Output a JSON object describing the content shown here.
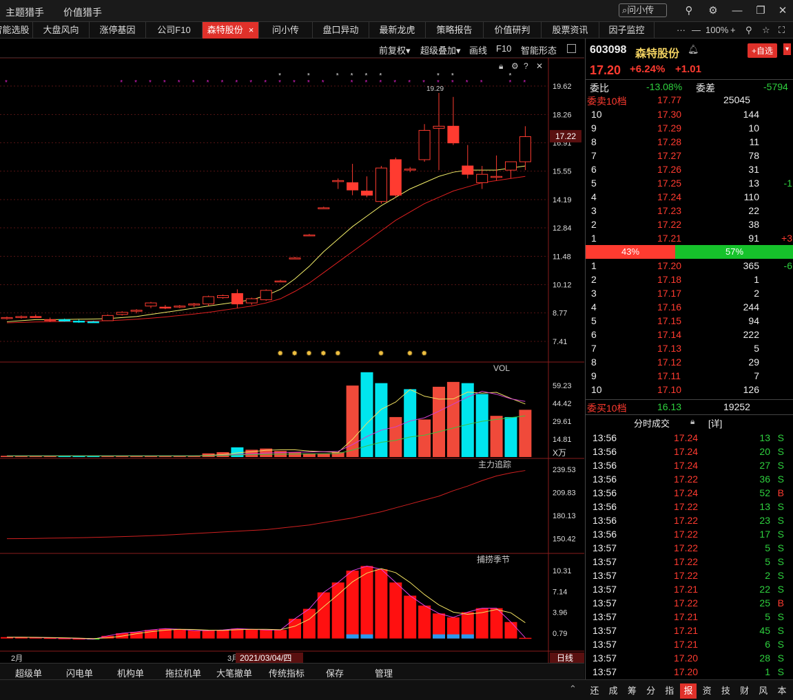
{
  "topmenu": [
    "主题猎手",
    "价值猎手"
  ],
  "search_label": "问小传",
  "tabs": [
    "智能选股",
    "大盘风向",
    "涨停基因",
    "公司F10",
    "森特股份",
    "问小传",
    "盘口异动",
    "最新龙虎",
    "策略报告",
    "价值研判",
    "股票资讯",
    "因子监控"
  ],
  "tab_close": "×",
  "tab_tools": {
    "more": "···",
    "minus": "—",
    "zoom": "100%",
    "plus": "+"
  },
  "toolbar": [
    "前复权▾",
    "超级叠加▾",
    "画线",
    "F10",
    "智能形态"
  ],
  "main_chart": {
    "y_labels": [
      "19.62",
      "18.26",
      "16.91",
      "15.55",
      "14.19",
      "12.84",
      "11.48",
      "10.12",
      "8.77",
      "7.41"
    ],
    "current_price": "17.22",
    "high_label": "19.29",
    "x_labels": [
      "2月",
      "3月"
    ],
    "date_tooltip": "2021/03/04/四",
    "period": "日线"
  },
  "vol_panel": {
    "title": "VOL",
    "y_labels": [
      "59.23",
      "44.42",
      "29.61",
      "14.81"
    ],
    "unit": "X万"
  },
  "main_force_panel": {
    "title": "主力追踪",
    "y_labels": [
      "239.53",
      "209.83",
      "180.13",
      "150.42"
    ]
  },
  "season_panel": {
    "title": "捕捞季节",
    "y_labels": [
      "10.31",
      "7.14",
      "3.96",
      "0.79"
    ]
  },
  "chart_data": {
    "type": "candlestick",
    "candles": [
      [
        8.5,
        8.6,
        8.45,
        8.55
      ],
      [
        8.55,
        8.65,
        8.5,
        8.6
      ],
      [
        8.6,
        8.7,
        8.55,
        8.55
      ],
      [
        8.45,
        8.55,
        8.35,
        8.4
      ],
      [
        8.45,
        8.5,
        8.35,
        8.38
      ],
      [
        8.38,
        8.45,
        8.3,
        8.33
      ],
      [
        8.35,
        8.4,
        8.3,
        8.32
      ],
      [
        8.4,
        8.7,
        8.38,
        8.65
      ],
      [
        8.7,
        8.85,
        8.65,
        8.8
      ],
      [
        8.85,
        8.95,
        8.75,
        8.9
      ],
      [
        9.1,
        9.3,
        9.0,
        9.25
      ],
      [
        9.05,
        9.15,
        8.95,
        9.0
      ],
      [
        9.05,
        9.15,
        9.0,
        9.1
      ],
      [
        9.15,
        9.25,
        9.05,
        9.2
      ],
      [
        9.2,
        9.6,
        9.1,
        9.55
      ],
      [
        9.5,
        9.65,
        9.45,
        9.6
      ],
      [
        9.7,
        9.9,
        9.0,
        9.2
      ],
      [
        9.25,
        9.5,
        9.15,
        9.45
      ],
      [
        9.4,
        9.9,
        9.35,
        9.85
      ],
      [
        10.3,
        10.35,
        10.25,
        10.3
      ],
      [
        11.4,
        11.45,
        11.35,
        11.4
      ],
      [
        12.5,
        12.55,
        12.45,
        12.5
      ],
      [
        13.8,
        13.85,
        13.75,
        13.8
      ],
      [
        15.1,
        15.2,
        14.7,
        15.1
      ],
      [
        15.0,
        15.9,
        14.4,
        14.65
      ],
      [
        14.6,
        15.3,
        14.3,
        14.4
      ],
      [
        14.1,
        15.8,
        14.0,
        15.7
      ],
      [
        16.1,
        16.2,
        14.3,
        14.4
      ],
      [
        15.6,
        15.75,
        15.5,
        15.65
      ],
      [
        16.1,
        17.8,
        16.0,
        17.5
      ],
      [
        17.6,
        19.29,
        15.6,
        17.7
      ],
      [
        17.7,
        19.1,
        16.8,
        16.9
      ],
      [
        15.8,
        16.8,
        15.2,
        15.4
      ],
      [
        15.0,
        15.8,
        14.7,
        15.4
      ],
      [
        15.25,
        16.3,
        15.1,
        15.3
      ],
      [
        15.6,
        16.0,
        15.2,
        16.0
      ],
      [
        16.0,
        17.7,
        15.6,
        17.2
      ]
    ],
    "ma_short": [
      8.35,
      8.4,
      8.45,
      8.45,
      8.46,
      8.47,
      8.48,
      8.5,
      8.55,
      8.6,
      8.7,
      8.8,
      8.9,
      9.0,
      9.1,
      9.2,
      9.3,
      9.4,
      9.6,
      9.9,
      10.4,
      11.0,
      11.7,
      12.3,
      12.9,
      13.4,
      13.9,
      14.3,
      14.7,
      15.0,
      15.3,
      15.5,
      15.6,
      15.6,
      15.6,
      15.7,
      15.8
    ],
    "ma_long": [
      8.3,
      8.32,
      8.34,
      8.35,
      8.36,
      8.37,
      8.38,
      8.4,
      8.43,
      8.47,
      8.52,
      8.58,
      8.65,
      8.72,
      8.8,
      8.9,
      9.0,
      9.1,
      9.25,
      9.45,
      9.8,
      10.2,
      10.7,
      11.2,
      11.7,
      12.2,
      12.7,
      13.2,
      13.6,
      14.0,
      14.3,
      14.6,
      14.8,
      15.0,
      15.1,
      15.2,
      15.3
    ],
    "volume": [
      1,
      1,
      1,
      1,
      1,
      1,
      1,
      1,
      1,
      1,
      1,
      1,
      1,
      1,
      3,
      4,
      8,
      6,
      7,
      5,
      4,
      3,
      3,
      4,
      59,
      70,
      61,
      33,
      56,
      31,
      58,
      62,
      61,
      52,
      34,
      33,
      39
    ],
    "volume_color": [
      "r",
      "r",
      "r",
      "r",
      "c",
      "c",
      "c",
      "r",
      "r",
      "r",
      "r",
      "r",
      "r",
      "r",
      "r",
      "r",
      "c",
      "r",
      "r",
      "r",
      "r",
      "r",
      "r",
      "r",
      "r",
      "c",
      "c",
      "r",
      "c",
      "r",
      "r",
      "r",
      "c",
      "c",
      "r",
      "c",
      "r"
    ],
    "main_force": [
      150.42,
      150.5,
      150.7,
      151,
      151.3,
      151.6,
      152,
      152.5,
      153,
      153.6,
      154.2,
      155,
      156,
      157,
      158,
      159,
      160,
      161,
      162,
      164,
      166,
      168,
      171,
      174,
      177,
      181,
      185,
      190,
      195,
      200,
      205,
      212,
      218,
      225,
      231,
      235,
      238
    ],
    "season": [
      0.2,
      0.2,
      0.15,
      0.1,
      0.05,
      0,
      -0.1,
      0.4,
      0.8,
      1.0,
      1.3,
      1.5,
      1.4,
      1.2,
      1.2,
      1.3,
      1.5,
      1.4,
      1.3,
      1.3,
      3.0,
      4.5,
      7.0,
      8.5,
      10.3,
      11.0,
      10.5,
      8.5,
      6.5,
      5.0,
      3.8,
      3.2,
      4.0,
      4.6,
      4.6,
      2.5,
      0.1
    ],
    "signals_top": [
      0,
      8,
      9,
      10,
      11,
      12,
      13,
      14,
      15,
      16,
      17,
      18,
      19,
      20,
      21,
      22,
      24,
      25,
      26,
      27,
      28,
      29,
      30,
      31,
      32,
      33,
      35,
      36
    ],
    "signals_white": [
      19,
      21,
      23,
      24,
      25,
      26,
      30,
      31,
      35
    ]
  },
  "quote": {
    "code": "603098",
    "name": "森特股份",
    "add_button": "+自选",
    "price": "17.20",
    "change_pct": "+6.24%",
    "change": "+1.01",
    "ratio_label": "委比",
    "ratio_value": "-13.08%",
    "diff_label": "委差",
    "diff_value": "-5794",
    "ask_summary_label": "委卖10档",
    "ask_summary_price": "17.77",
    "ask_summary_vol": "25045",
    "asks": [
      {
        "level": "10",
        "price": "17.30",
        "vol": "144",
        "chg": ""
      },
      {
        "level": "9",
        "price": "17.29",
        "vol": "10",
        "chg": ""
      },
      {
        "level": "8",
        "price": "17.28",
        "vol": "11",
        "chg": ""
      },
      {
        "level": "7",
        "price": "17.27",
        "vol": "78",
        "chg": ""
      },
      {
        "level": "6",
        "price": "17.26",
        "vol": "31",
        "chg": ""
      },
      {
        "level": "5",
        "price": "17.25",
        "vol": "13",
        "chg": "-1"
      },
      {
        "level": "4",
        "price": "17.24",
        "vol": "110",
        "chg": ""
      },
      {
        "level": "3",
        "price": "17.23",
        "vol": "22",
        "chg": ""
      },
      {
        "level": "2",
        "price": "17.22",
        "vol": "38",
        "chg": ""
      },
      {
        "level": "1",
        "price": "17.21",
        "vol": "91",
        "chg": "+3"
      }
    ],
    "buy_pct": "43%",
    "sell_pct": "57%",
    "bids": [
      {
        "level": "1",
        "price": "17.20",
        "vol": "365",
        "chg": "-6"
      },
      {
        "level": "2",
        "price": "17.18",
        "vol": "1",
        "chg": ""
      },
      {
        "level": "3",
        "price": "17.17",
        "vol": "2",
        "chg": ""
      },
      {
        "level": "4",
        "price": "17.16",
        "vol": "244",
        "chg": ""
      },
      {
        "level": "5",
        "price": "17.15",
        "vol": "94",
        "chg": ""
      },
      {
        "level": "6",
        "price": "17.14",
        "vol": "222",
        "chg": ""
      },
      {
        "level": "7",
        "price": "17.13",
        "vol": "5",
        "chg": ""
      },
      {
        "level": "8",
        "price": "17.12",
        "vol": "29",
        "chg": ""
      },
      {
        "level": "9",
        "price": "17.11",
        "vol": "7",
        "chg": ""
      },
      {
        "level": "10",
        "price": "17.10",
        "vol": "126",
        "chg": ""
      }
    ],
    "bid_summary_label": "委买10档",
    "bid_summary_price": "16.13",
    "bid_summary_vol": "19252",
    "trades_title": "分时成交",
    "trades_detail": "[详]",
    "trades": [
      [
        "13:56",
        "17.24",
        "13",
        "S"
      ],
      [
        "13:56",
        "17.24",
        "20",
        "S"
      ],
      [
        "13:56",
        "17.24",
        "27",
        "S"
      ],
      [
        "13:56",
        "17.22",
        "36",
        "S"
      ],
      [
        "13:56",
        "17.24",
        "52",
        "B"
      ],
      [
        "13:56",
        "17.22",
        "13",
        "S"
      ],
      [
        "13:56",
        "17.22",
        "23",
        "S"
      ],
      [
        "13:56",
        "17.22",
        "17",
        "S"
      ],
      [
        "13:57",
        "17.22",
        "5",
        "S"
      ],
      [
        "13:57",
        "17.22",
        "5",
        "S"
      ],
      [
        "13:57",
        "17.22",
        "2",
        "S"
      ],
      [
        "13:57",
        "17.21",
        "22",
        "S"
      ],
      [
        "13:57",
        "17.22",
        "25",
        "B"
      ],
      [
        "13:57",
        "17.21",
        "5",
        "S"
      ],
      [
        "13:57",
        "17.21",
        "45",
        "S"
      ],
      [
        "13:57",
        "17.21",
        "6",
        "S"
      ],
      [
        "13:57",
        "17.20",
        "28",
        "S"
      ],
      [
        "13:57",
        "17.20",
        "1",
        "S"
      ]
    ]
  },
  "bottom_tabs": [
    "超级单",
    "闪电单",
    "机构单",
    "拖拉机单",
    "大笔撤单",
    "传统指标",
    "保存",
    "管理"
  ],
  "right_tabs": [
    "还",
    "成",
    "筹",
    "分",
    "指",
    "报",
    "资",
    "技",
    "财",
    "风",
    "本"
  ],
  "colors": {
    "up": "#ff3b30",
    "down": "#00e5ee",
    "green": "#2ed13e",
    "accent": "#e0312a",
    "ma_short": "#f5f06a",
    "ma_long": "#e02020"
  }
}
